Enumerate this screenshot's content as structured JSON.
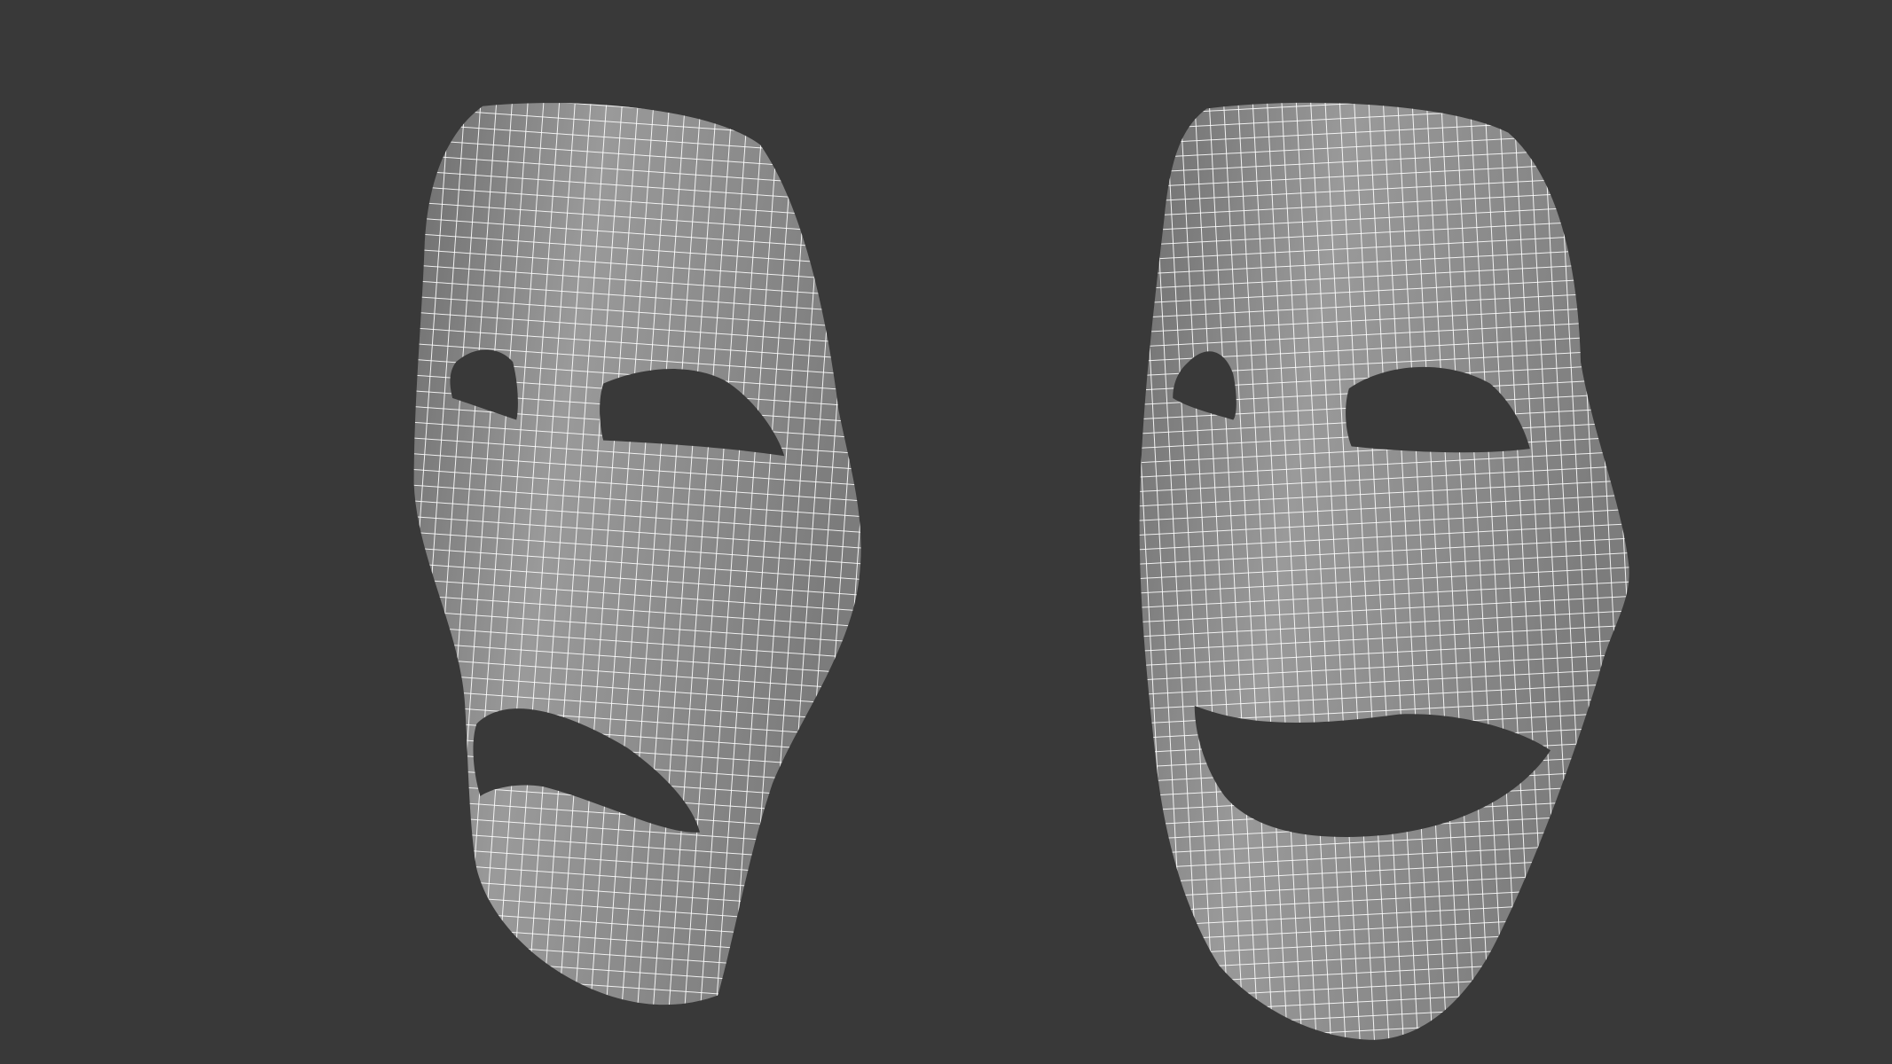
{
  "scene": {
    "background_color": "#393939",
    "mesh_surface_color": "#8a8a8a",
    "mesh_shadow_color": "#5e5e5e",
    "wireframe_color": "#ffffff",
    "objects": [
      {
        "id": "tragedy-mask",
        "expression": "sad"
      },
      {
        "id": "comedy-mask",
        "expression": "happy"
      }
    ]
  }
}
